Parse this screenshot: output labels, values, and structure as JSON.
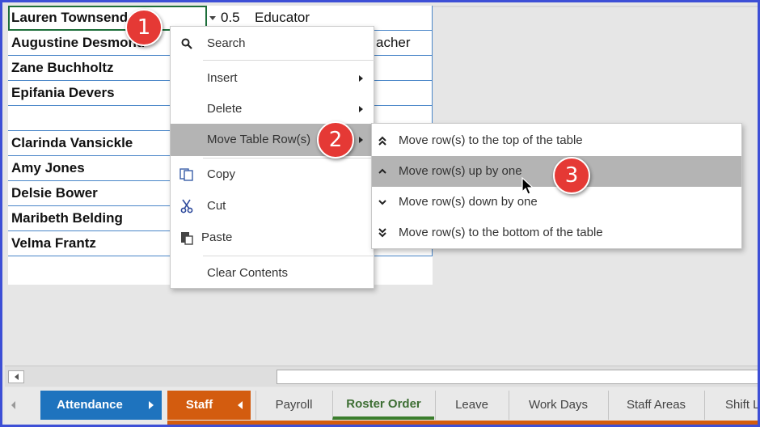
{
  "sheet": {
    "rows": [
      {
        "name": "Lauren Townsend",
        "c2": "0.5",
        "c3": "Educator"
      },
      {
        "name": "Augustine Desmond",
        "c2": "",
        "c3": "acher"
      },
      {
        "name": "Zane Buchholtz",
        "c2": "",
        "c3": ""
      },
      {
        "name": "Epifania Devers",
        "c2": "",
        "c3": ""
      },
      {
        "name": "",
        "c2": "",
        "c3": ""
      },
      {
        "name": "Clarinda Vansickle",
        "c2": "",
        "c3": ""
      },
      {
        "name": "Amy Jones",
        "c2": "",
        "c3": ""
      },
      {
        "name": "Delsie Bower",
        "c2": "",
        "c3": ""
      },
      {
        "name": "Maribeth Belding",
        "c2": "",
        "c3": ""
      },
      {
        "name": "Velma Frantz",
        "c2": "",
        "c3": ""
      }
    ]
  },
  "badges": [
    "1",
    "2",
    "3"
  ],
  "context_menu": {
    "search": "Search",
    "insert": "Insert",
    "delete": "Delete",
    "move_table_rows": "Move Table Row(s)",
    "copy": "Copy",
    "cut": "Cut",
    "paste": "Paste",
    "clear_contents": "Clear Contents"
  },
  "submenu": {
    "top": "Move row(s) to the top of the table",
    "up": "Move row(s) up by one",
    "down": "Move row(s) down by one",
    "bottom": "Move row(s) to the bottom of the table"
  },
  "tabs": {
    "attendance": "Attendance",
    "staff": "Staff",
    "payroll": "Payroll",
    "roster_order": "Roster Order",
    "leave": "Leave",
    "work_days": "Work Days",
    "staff_areas": "Staff Areas",
    "shift": "Shift L"
  },
  "colors": {
    "frame": "#3d4fd6",
    "badge": "#e53935",
    "attendance_tab": "#1e73be",
    "staff_tab": "#d35c0f",
    "active_tab": "#3a7d2c",
    "menu_highlight": "#b4b4b4"
  },
  "icons": {
    "search": "magnifier-icon",
    "copy": "copy-icon",
    "cut": "scissors-icon",
    "paste": "paste-icon",
    "top": "double-chevron-up-icon",
    "up": "chevron-up-icon",
    "down": "chevron-down-icon",
    "bottom": "double-chevron-down-icon"
  }
}
